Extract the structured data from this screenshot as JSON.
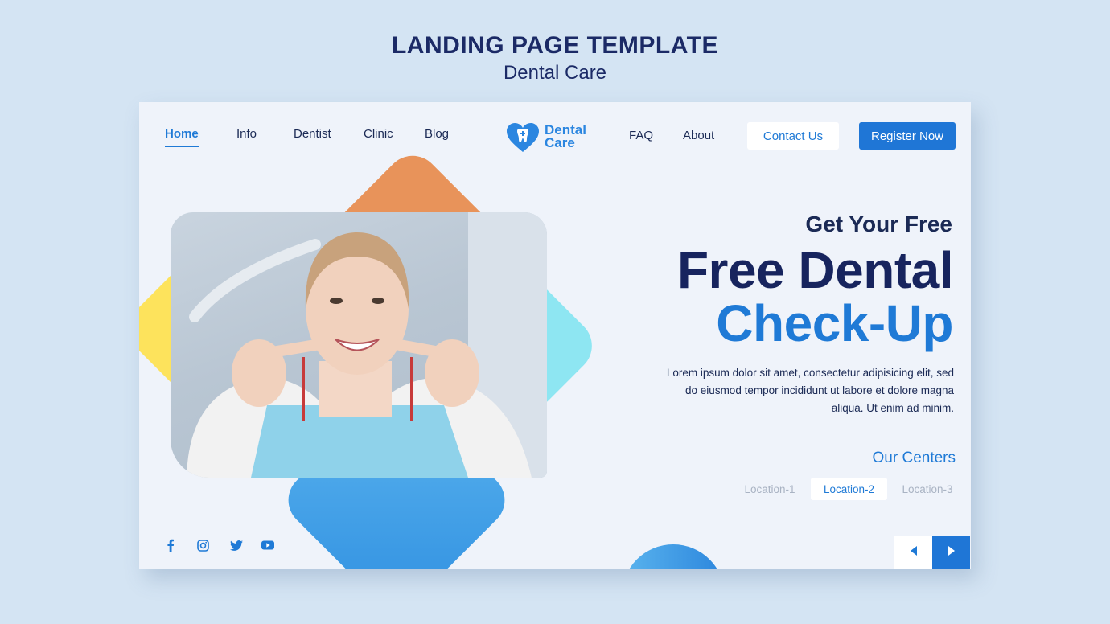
{
  "header": {
    "title": "LANDING PAGE TEMPLATE",
    "subtitle": "Dental Care"
  },
  "nav": {
    "left_items": [
      "Home",
      "Info",
      "Dentist",
      "Clinic",
      "Blog"
    ],
    "active": "Home",
    "right_items": [
      "FAQ",
      "About"
    ],
    "contact_label": "Contact Us",
    "register_label": "Register Now"
  },
  "logo": {
    "line1": "Dental",
    "line2": "Care",
    "icon": "heart-tooth-icon"
  },
  "hero": {
    "kicker": "Get Your Free",
    "title_line1": "Free Dental",
    "title_line2": "Check-Up",
    "description": "Lorem ipsum dolor sit amet, consectetur adipisicing elit, sed do eiusmod tempor incididunt ut labore et dolore magna aliqua. Ut enim ad minim."
  },
  "centers": {
    "title": "Our Centers",
    "locations": [
      "Location-1",
      "Location-2",
      "Location-3"
    ],
    "selected": "Location-2"
  },
  "social": {
    "icons": [
      "facebook-icon",
      "instagram-icon",
      "twitter-icon",
      "youtube-icon"
    ]
  },
  "pager": {
    "icons": [
      "arrow-left-icon",
      "arrow-right-icon"
    ]
  },
  "colors": {
    "background": "#d4e4f3",
    "card": "#eff3fa",
    "primary": "#1f7ad6",
    "navy": "#17245e",
    "orange": "#e8935a",
    "yellow": "#fde35c",
    "cyan": "#8ee6f2",
    "blue": "#3a9ee8"
  }
}
